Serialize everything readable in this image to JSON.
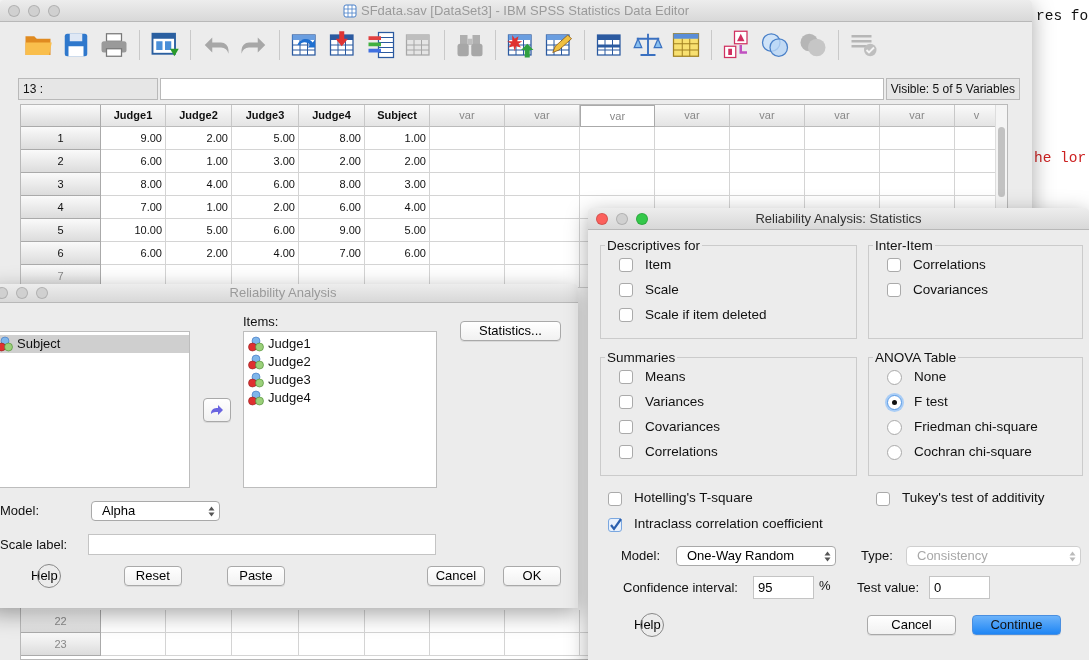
{
  "background_text": [
    {
      "text": "res fo",
      "color": "#111111"
    },
    {
      "text": "he lor",
      "color": "#cc2222"
    }
  ],
  "editor": {
    "title": "SFdata.sav [DataSet3] - IBM SPSS Statistics Data Editor",
    "active": false,
    "toolbar": [
      {
        "kind": "folder",
        "disabled": false
      },
      {
        "kind": "floppy",
        "disabled": false
      },
      {
        "kind": "printer",
        "disabled": false
      },
      {
        "kind": "separator"
      },
      {
        "kind": "window-arrow",
        "disabled": false
      },
      {
        "kind": "separator"
      },
      {
        "kind": "undo",
        "disabled": true
      },
      {
        "kind": "redo",
        "disabled": true
      },
      {
        "kind": "separator"
      },
      {
        "kind": "table-arrow",
        "disabled": false
      },
      {
        "kind": "table-down",
        "disabled": false
      },
      {
        "kind": "table-bars",
        "disabled": false
      },
      {
        "kind": "table",
        "disabled": true
      },
      {
        "kind": "separator"
      },
      {
        "kind": "binoculars",
        "disabled": true
      },
      {
        "kind": "separator"
      },
      {
        "kind": "table-star",
        "disabled": false
      },
      {
        "kind": "table-pencil",
        "disabled": false
      },
      {
        "kind": "separator"
      },
      {
        "kind": "split-table",
        "disabled": false
      },
      {
        "kind": "scales",
        "disabled": false
      },
      {
        "kind": "table-grid",
        "disabled": false
      },
      {
        "kind": "separator"
      },
      {
        "kind": "label",
        "disabled": false
      },
      {
        "kind": "circles",
        "disabled": false
      },
      {
        "kind": "circles-filled",
        "disabled": true
      },
      {
        "kind": "separator"
      },
      {
        "kind": "spellcheck",
        "disabled": true
      }
    ],
    "cell_ref": "13 :",
    "visible_info": "Visible: 5 of 5 Variables",
    "columns": [
      {
        "label": "Judge1",
        "kind": "variable",
        "selected": false
      },
      {
        "label": "Judge2",
        "kind": "variable",
        "selected": false
      },
      {
        "label": "Judge3",
        "kind": "variable",
        "selected": false
      },
      {
        "label": "Judge4",
        "kind": "variable",
        "selected": false
      },
      {
        "label": "Subject",
        "kind": "variable",
        "selected": false
      },
      {
        "label": "var",
        "kind": "empty",
        "selected": false
      },
      {
        "label": "var",
        "kind": "empty",
        "selected": false
      },
      {
        "label": "var",
        "kind": "empty",
        "selected": true
      },
      {
        "label": "var",
        "kind": "empty",
        "selected": false
      },
      {
        "label": "var",
        "kind": "empty",
        "selected": false
      },
      {
        "label": "var",
        "kind": "empty",
        "selected": false
      },
      {
        "label": "var",
        "kind": "empty",
        "selected": false
      },
      {
        "label": "v",
        "kind": "empty",
        "selected": false
      }
    ],
    "rows": [
      {
        "label": "1",
        "cells": [
          "9.00",
          "2.00",
          "5.00",
          "8.00",
          "1.00"
        ]
      },
      {
        "label": "2",
        "cells": [
          "6.00",
          "1.00",
          "3.00",
          "2.00",
          "2.00"
        ]
      },
      {
        "label": "3",
        "cells": [
          "8.00",
          "4.00",
          "6.00",
          "8.00",
          "3.00"
        ]
      },
      {
        "label": "4",
        "cells": [
          "7.00",
          "1.00",
          "2.00",
          "6.00",
          "4.00"
        ]
      },
      {
        "label": "5",
        "cells": [
          "10.00",
          "5.00",
          "6.00",
          "9.00",
          "5.00"
        ]
      },
      {
        "label": "6",
        "cells": [
          "6.00",
          "2.00",
          "4.00",
          "7.00",
          "6.00"
        ]
      },
      {
        "label": "7",
        "cells": []
      }
    ],
    "bottom_rows": [
      {
        "label": "22",
        "cells": []
      },
      {
        "label": "23",
        "cells": []
      }
    ]
  },
  "reliability_dialog": {
    "title": "Reliability Analysis",
    "active": false,
    "variables": [
      {
        "label": "Subject",
        "selected": true
      }
    ],
    "items_label": "Items:",
    "items": [
      {
        "label": "Judge1",
        "selected": false
      },
      {
        "label": "Judge2",
        "selected": false
      },
      {
        "label": "Judge3",
        "selected": false
      },
      {
        "label": "Judge4",
        "selected": false
      }
    ],
    "statistics_button": "Statistics...",
    "model_label": "Model:",
    "model_value": "Alpha",
    "scale_label": "Scale label:",
    "help": "Help",
    "buttons": [
      "Reset",
      "Paste",
      "Cancel",
      "OK"
    ]
  },
  "statistics_dialog": {
    "title": "Reliability Analysis: Statistics",
    "active": true,
    "groups": [
      {
        "title": "Descriptives for",
        "kind": "checkbox",
        "options": [
          {
            "label": "Item",
            "checked": false
          },
          {
            "label": "Scale",
            "checked": false
          },
          {
            "label": "Scale if item deleted",
            "checked": false
          }
        ]
      },
      {
        "title": "Inter-Item",
        "kind": "checkbox",
        "options": [
          {
            "label": "Correlations",
            "checked": false
          },
          {
            "label": "Covariances",
            "checked": false
          }
        ]
      },
      {
        "title": "Summaries",
        "kind": "checkbox",
        "options": [
          {
            "label": "Means",
            "checked": false
          },
          {
            "label": "Variances",
            "checked": false
          },
          {
            "label": "Covariances",
            "checked": false
          },
          {
            "label": "Correlations",
            "checked": false
          }
        ]
      },
      {
        "title": "ANOVA Table",
        "kind": "radio",
        "options": [
          {
            "label": "None",
            "selected": false
          },
          {
            "label": "F test",
            "selected": true
          },
          {
            "label": "Friedman chi-square",
            "selected": false
          },
          {
            "label": "Cochran chi-square",
            "selected": false
          }
        ]
      }
    ],
    "options": [
      {
        "label": "Hotelling's T-square",
        "checked": false
      },
      {
        "label": "Tukey's test of additivity",
        "checked": false
      },
      {
        "label": "Intraclass correlation coefficient",
        "checked": true
      }
    ],
    "model_label": "Model:",
    "model_value": "One-Way Random",
    "type_label": "Type:",
    "type_value": "Consistency",
    "type_disabled": true,
    "ci_label": "Confidence interval:",
    "ci_value": "95",
    "ci_unit": "%",
    "test_label": "Test value:",
    "test_value": "0",
    "help": "Help",
    "buttons": [
      {
        "label": "Cancel",
        "default": false
      },
      {
        "label": "Continue",
        "default": true
      }
    ]
  }
}
